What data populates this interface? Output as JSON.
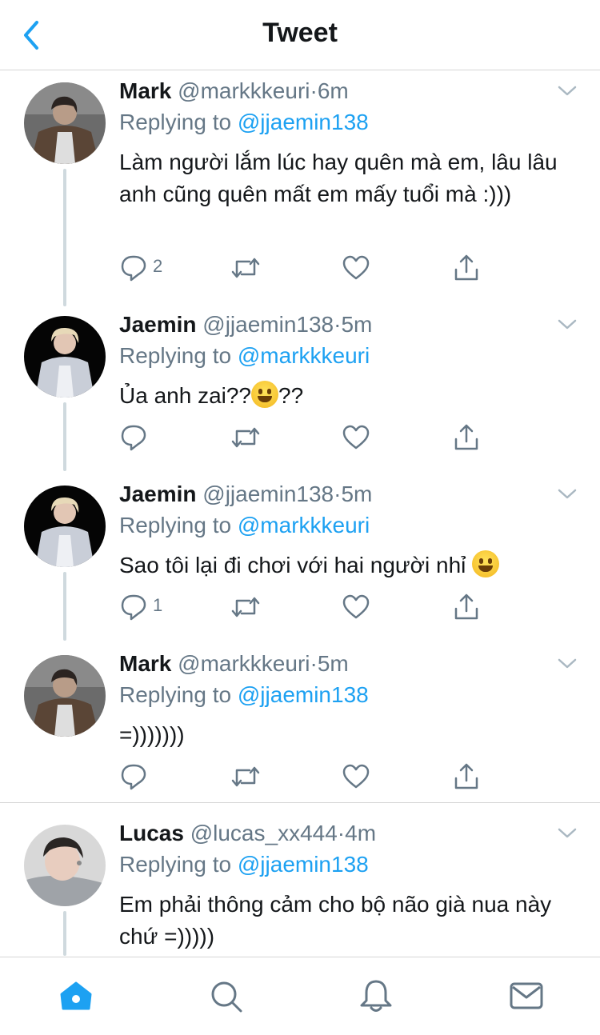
{
  "header": {
    "title": "Tweet"
  },
  "tweets": [
    {
      "name": "Mark",
      "handle": "@markkkeuri",
      "dot": "·",
      "time": "6m",
      "replying_prefix": "Replying to ",
      "replying_to": "@jjaemin138",
      "text": "Làm người lắm lúc hay quên mà em, lâu lâu anh cũng quên mất em mấy tuổi mà :)))",
      "reply_count": "2"
    },
    {
      "name": "Jaemin",
      "handle": "@jjaemin138",
      "dot": "·",
      "time": "5m",
      "replying_prefix": "Replying to ",
      "replying_to": "@markkkeuri",
      "text_before": "Ủa anh zai??",
      "text_emoji": "grinning-face-emoji",
      "text_after": "??",
      "reply_count": ""
    },
    {
      "name": "Jaemin",
      "handle": "@jjaemin138",
      "dot": "·",
      "time": "5m",
      "replying_prefix": "Replying to ",
      "replying_to": "@markkkeuri",
      "text_before": "Sao tôi lại đi chơi với hai người nhỉ ",
      "text_emoji": "grinning-face-emoji",
      "text_after": "",
      "reply_count": "1"
    },
    {
      "name": "Mark",
      "handle": "@markkkeuri",
      "dot": "·",
      "time": "5m",
      "replying_prefix": "Replying to ",
      "replying_to": "@jjaemin138",
      "text": "=)))))))",
      "reply_count": ""
    },
    {
      "name": "Lucas",
      "handle": "@lucas_xx444",
      "dot": "·",
      "time": "4m",
      "replying_prefix": "Replying to ",
      "replying_to": "@jjaemin138",
      "text": "Em phải thông cảm cho bộ não già nua này chứ =)))))"
    }
  ],
  "icons": {
    "back": "chevron-left-icon",
    "caret": "chevron-down-icon",
    "reply": "reply-icon",
    "retweet": "retweet-icon",
    "like": "heart-icon",
    "share": "share-icon",
    "tabs": [
      "home-icon",
      "search-icon",
      "notifications-icon",
      "messages-icon"
    ]
  },
  "colors": {
    "accent": "#1da1f2",
    "secondary_text": "#657786",
    "text": "#14171a",
    "active_tab": "#1da1f2"
  }
}
